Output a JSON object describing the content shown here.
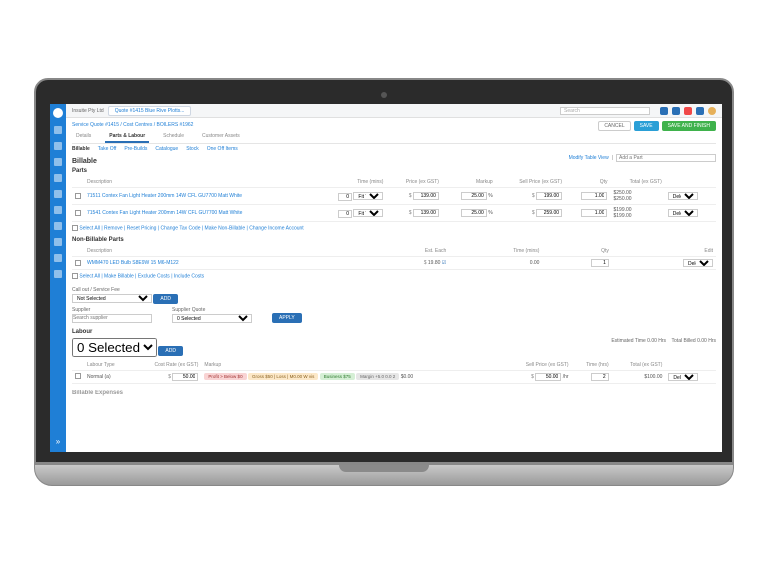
{
  "header": {
    "company": "Insuite Pty Ltd",
    "tab_label": "Quote #1415 Blue Rive Plotts...",
    "search_placeholder": "Search"
  },
  "breadcrumb": "Service Quote #1415 / Cost Centres / BOILERS #1962",
  "actions": {
    "cancel": "CANCEL",
    "save": "SAVE",
    "finish": "SAVE AND FINISH"
  },
  "tabs": {
    "details": "Details",
    "parts": "Parts & Labour",
    "schedule": "Schedule",
    "custom": "Customer Assets"
  },
  "subtabs": {
    "billable": "Billable",
    "takeoff": "Take Off",
    "prebuilds": "Pre-Builds",
    "catalogue": "Catalogue",
    "stock": "Stock",
    "oneoff": "One Off Items"
  },
  "billable": {
    "title": "Billable",
    "modify_link": "Modify Table View",
    "add_part_btn": "Add a Part",
    "parts_title": "Parts",
    "cols": {
      "desc": "Description",
      "time": "Time (mins)",
      "price": "Price (ex GST)",
      "markup": "Markup",
      "sell": "Sell Price (ex GST)",
      "qty": "Qty",
      "total": "Total (ex GST)"
    },
    "rows": [
      {
        "desc": "71511 Contex Fan Light Heater 200mm 14W CFL GU7700 Matt White",
        "time": "0",
        "fit": "Fit Time",
        "price": "139.00",
        "markup": "25.00",
        "sell": "199.00",
        "qty": "1.00",
        "total1": "$250.00",
        "total2": "$250.00",
        "action": "Delete"
      },
      {
        "desc": "71541 Contex Fan Light Heater 200mm 14W CFL GU7700 Matt White",
        "time": "0",
        "fit": "Fit Time",
        "price": "139.00",
        "markup": "25.00",
        "sell": "259.00",
        "qty": "1.00",
        "total1": "$199.00",
        "total2": "$199.00",
        "action": "Delete"
      }
    ],
    "select_links": "Select All | Remove | Reset Pricing | Change Tax Code | Make Non-Billable | Change Income Account"
  },
  "nonbill": {
    "title": "Non-Billable Parts",
    "cols": {
      "desc": "Description",
      "est": "Est. Each",
      "time": "Time (mins)",
      "qty": "Qty",
      "edit": "Edit"
    },
    "row": {
      "desc": "WMM470 LED Bulb S8E9W 15 M6-M122",
      "est": "19.80",
      "time": "0.00",
      "qty": "1",
      "action": "Delete"
    },
    "select_links": "Select All | Make Billable | Exclude Costs | Include Costs"
  },
  "callout": {
    "label": "Call out / Service Fee",
    "opt": "Not Selected",
    "add": "ADD"
  },
  "supplier": {
    "label": "Supplier",
    "ph": "Search supplier",
    "quote_label": "Supplier Quote",
    "quote_opt": "0 Selected",
    "apply": "APPLY"
  },
  "labour": {
    "title": "Labour",
    "opt": "0 Selected",
    "add": "ADD",
    "est_time": "Estimated Time  0.00 Hrs",
    "total_billed": "Total Billed  0.00 Hrs",
    "cols": {
      "type": "Labour Type",
      "cost": "Cost Rate (ex GST)",
      "markup": "Markup",
      "sell": "Sell Price (ex GST)",
      "time": "Time (hrs)",
      "total": "Total (ex GST)"
    },
    "row": {
      "type": "Normal (a)",
      "cost": "50.00",
      "profit_labels": [
        "Profit > Below $0",
        "Gross $50 | Loss | M0.00 W vis",
        "Business $75",
        "Margin +5.0 0.0 2",
        "$0.00"
      ],
      "sell": "50.00",
      "sell_suffix": "/hr",
      "time": "2",
      "total": "$100.00",
      "action": "Delete"
    }
  },
  "next_section": "Billable Expenses"
}
